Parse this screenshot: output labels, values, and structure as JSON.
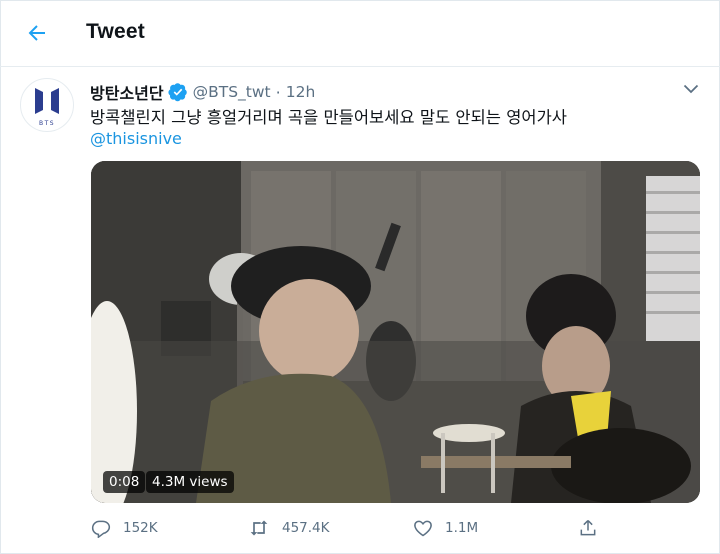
{
  "header": {
    "title": "Tweet",
    "back_icon": "back-arrow-icon"
  },
  "tweet": {
    "author": {
      "display_name": "방탄소년단",
      "handle": "@BTS_twt",
      "avatar_text": "BTS"
    },
    "separator": "·",
    "time": "12h",
    "text": "방콕챌린지 그냥 흥얼거리며 곡을 만들어보세요 말도 안되는 영어가사",
    "mention": "@thisisnive",
    "video": {
      "duration": "0:08",
      "views": "4.3M views"
    },
    "stats": {
      "replies": "152K",
      "retweets": "457.4K",
      "likes": "1.1M"
    }
  },
  "colors": {
    "accent": "#1da1f2",
    "muted": "#5b7083",
    "verified": "#1da1f2",
    "bts_logo": "#2b3d8f"
  }
}
